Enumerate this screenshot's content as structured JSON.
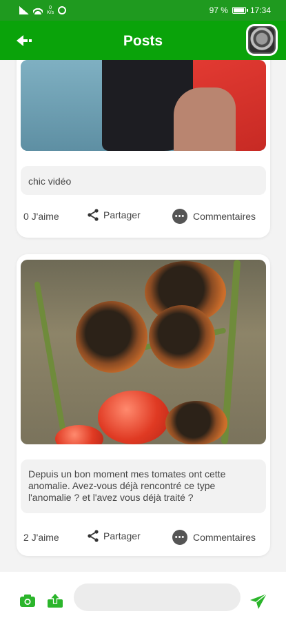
{
  "status_bar": {
    "network_speed": "0\nK/s",
    "battery": "97 %",
    "battery_level": 0.97,
    "time": "17:34"
  },
  "header": {
    "title": "Posts"
  },
  "posts": [
    {
      "caption": "chic vidéo",
      "likes": "0 J'aime",
      "share_label": "Partager",
      "comments_label": "Commentaires"
    },
    {
      "caption": "Depuis un bon moment mes tomates ont cette anomalie. Avez-vous déjà rencontré ce type l'anomalie ? et l'avez vous déjà traité ?",
      "likes": "2 J'aime",
      "share_label": "Partager",
      "comments_label": "Commentaires"
    }
  ],
  "composer": {
    "placeholder": ""
  },
  "colors": {
    "app_bar": "#0aa30a",
    "status_bar": "#1f9a1f",
    "accent_icons": "#2bb52b"
  },
  "icons": {
    "back": "logout-arrow-icon",
    "share": "share-icon",
    "comments": "comment-bubble-icon",
    "camera": "camera-icon",
    "upload": "upload-icon",
    "send": "send-icon"
  }
}
